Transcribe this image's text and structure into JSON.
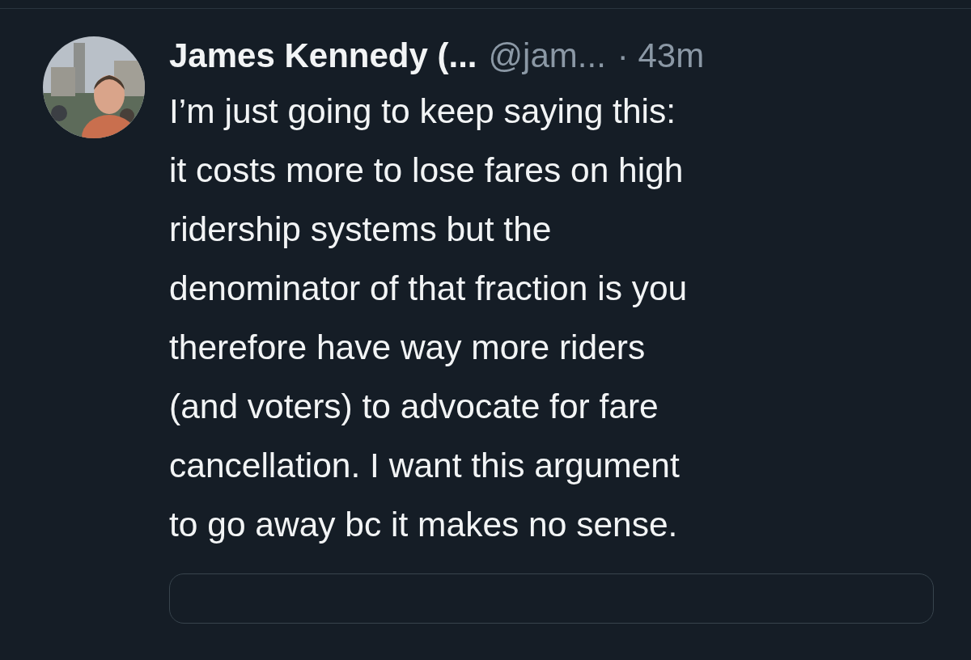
{
  "tweet": {
    "author": {
      "name": "James Kennedy (...",
      "handle": "@jam...",
      "time": "· 43m"
    },
    "body_lines": [
      "I’m just going to keep saying this:",
      "it costs more to lose fares on high",
      "ridership systems but the",
      "denominator of that fraction is you",
      "therefore have way more riders",
      "(and voters) to advocate for fare",
      "cancellation. I want this argument",
      "to go away bc it makes no sense."
    ]
  }
}
